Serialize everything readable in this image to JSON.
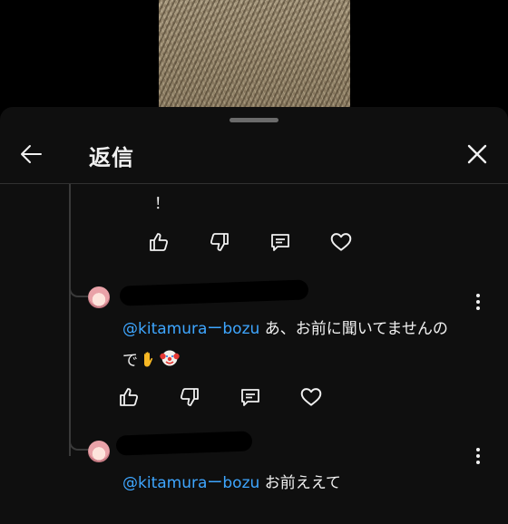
{
  "panel": {
    "title": "返信"
  },
  "comments": [
    {
      "text": "！"
    },
    {
      "mention": "@kitamuraーbozu",
      "text_line1": " あ、お前に聞いてませんの",
      "text_line2": "で"
    },
    {
      "mention": "@kitamuraーbozu",
      "text_line1": " お前ええて"
    }
  ],
  "icons": {
    "back": "arrow-left-icon",
    "close": "close-icon",
    "like": "thumb-up-icon",
    "dislike": "thumb-down-icon",
    "reply": "reply-comment-icon",
    "heart": "heart-icon",
    "more": "more-vertical-icon"
  },
  "colors": {
    "mention": "#3ea6ff",
    "sheet": "#0f0f0f",
    "text": "#f1f1f1"
  }
}
